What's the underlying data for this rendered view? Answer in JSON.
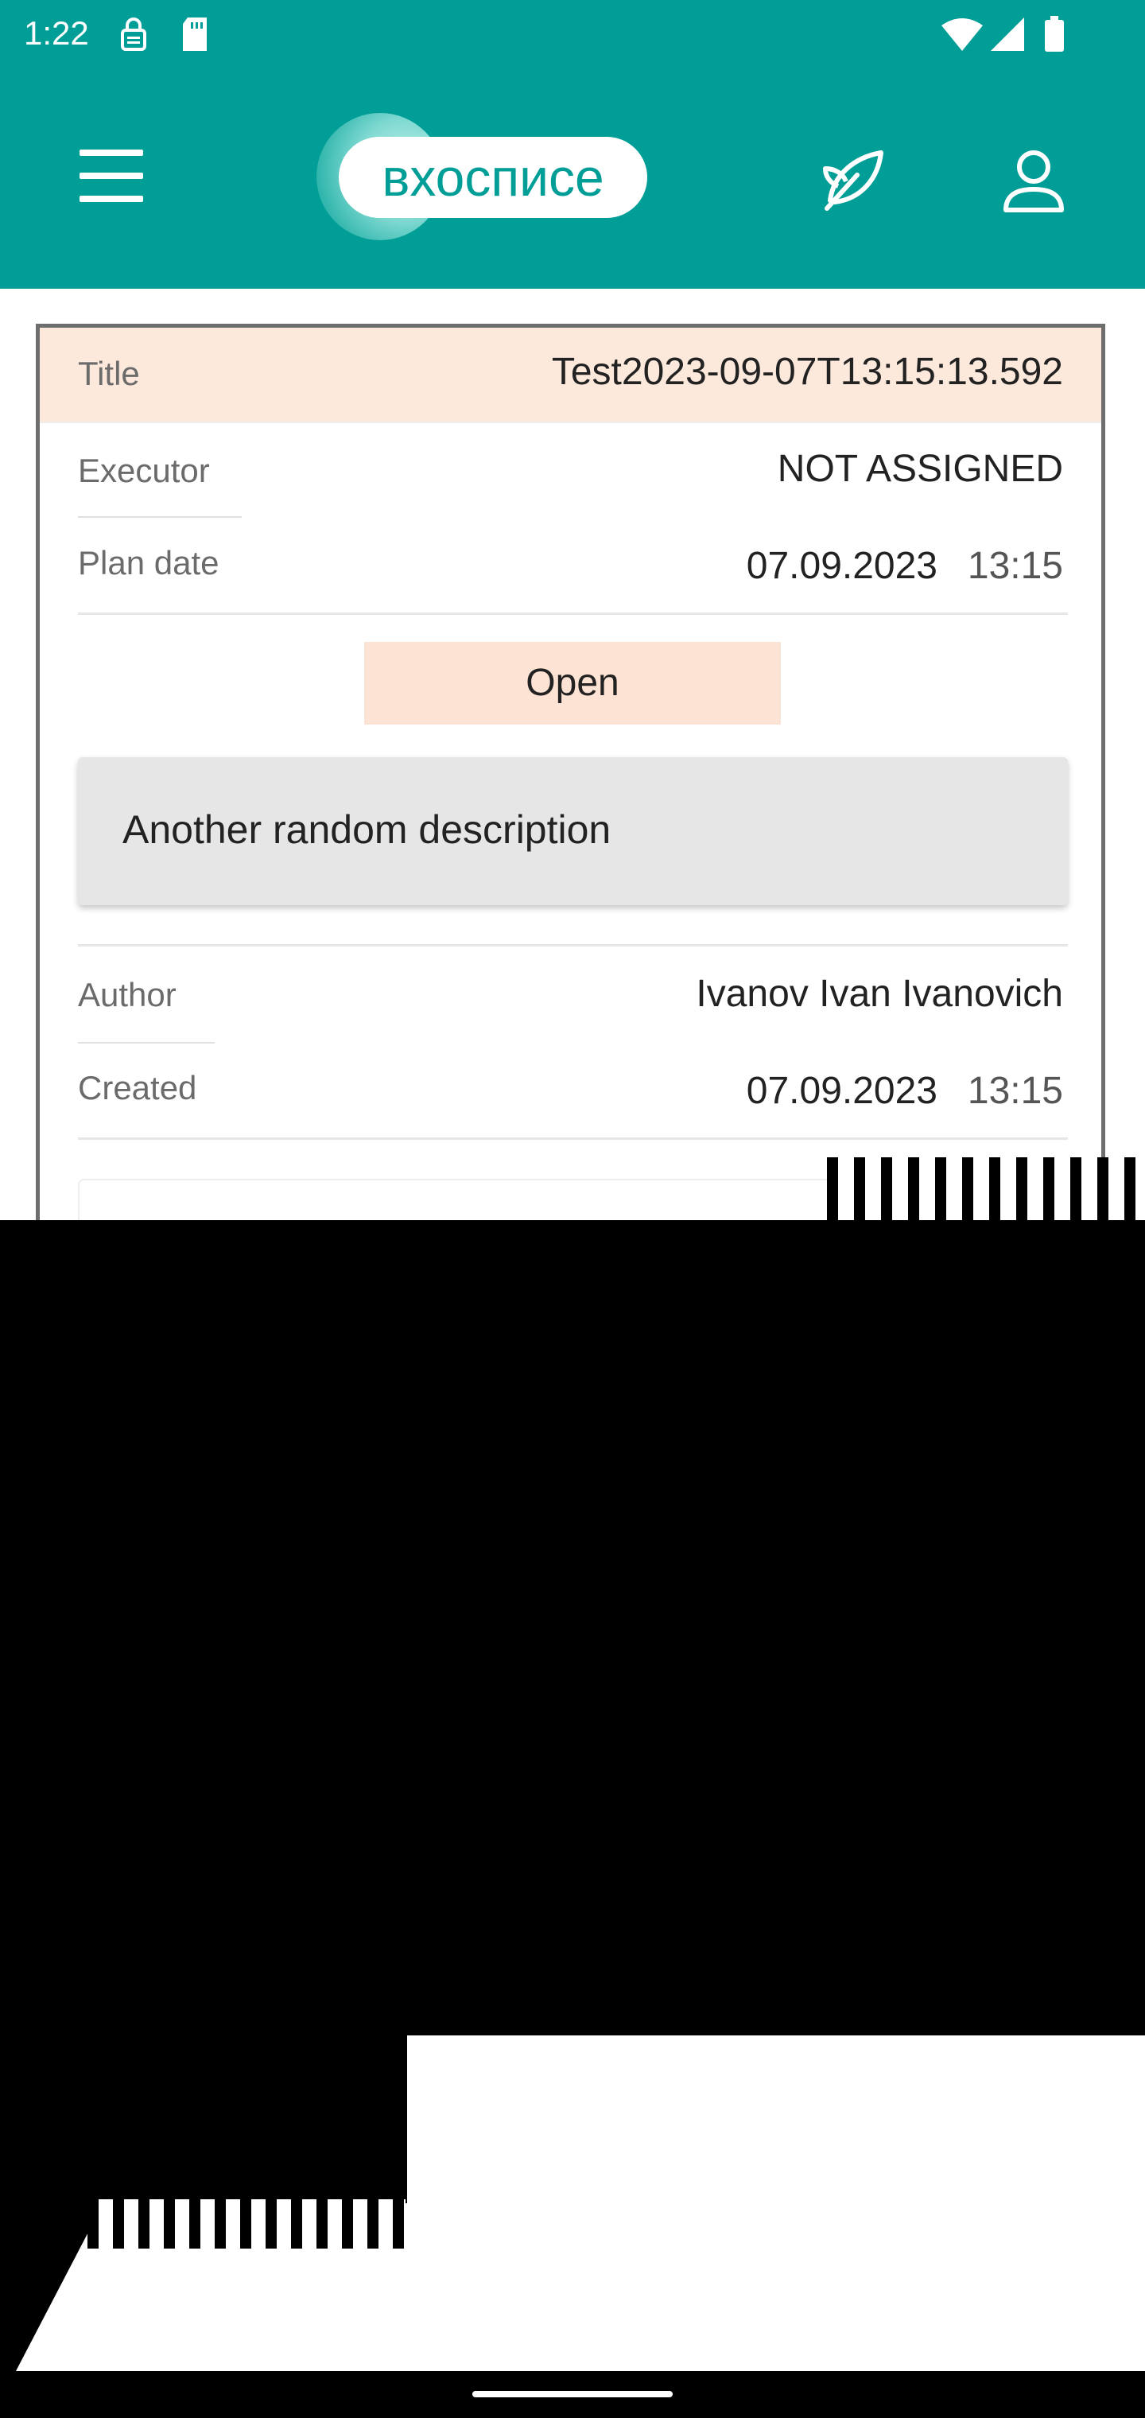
{
  "status_bar": {
    "time": "1:22",
    "icons": [
      "sim-lock-icon",
      "sd-card-icon",
      "wifi-icon",
      "signal-icon",
      "battery-icon"
    ]
  },
  "app_bar": {
    "logo_text": "вхосписе",
    "color": "#009e96",
    "icons": [
      "menu-icon",
      "leaf-icon",
      "profile-icon"
    ]
  },
  "task": {
    "title_label": "Title",
    "title_value": "Test2023-09-07T13:15:13.592",
    "executor_label": "Executor",
    "executor_value": "NOT ASSIGNED",
    "plan_date_label": "Plan date",
    "plan_date": "07.09.2023",
    "plan_time": "13:15",
    "status": "Open",
    "description": "Another random description",
    "author_label": "Author",
    "author_value": "Ivanov Ivan Ivanovich",
    "created_label": "Created",
    "created_date": "07.09.2023",
    "created_time": "13:15"
  },
  "colors": {
    "accent": "#009e96",
    "title_bg": "#fde8dc",
    "status_bg": "#fde3d3",
    "description_bg": "#e6e6e6"
  }
}
